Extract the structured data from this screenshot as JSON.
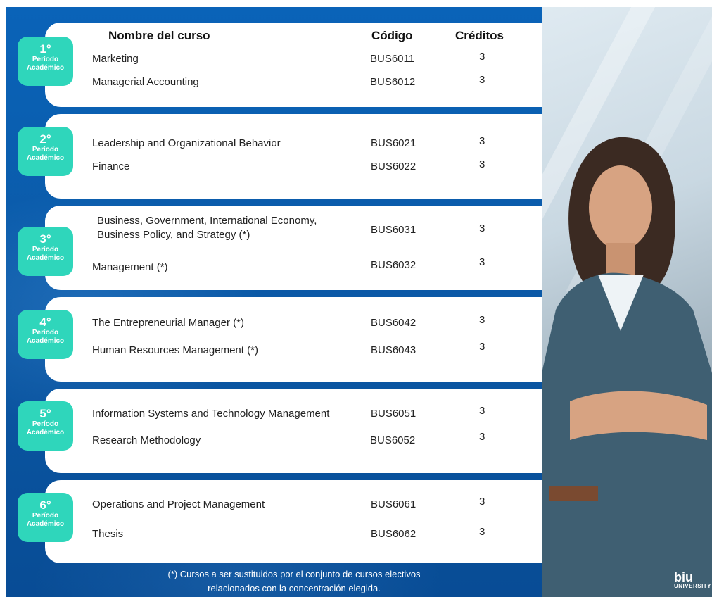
{
  "headers": {
    "course": "Nombre del curso",
    "code": "Código",
    "credits": "Créditos"
  },
  "periods": [
    {
      "num": "1°",
      "label1": "Período",
      "label2": "Académico",
      "courses": [
        {
          "name": "Marketing",
          "code": "BUS6011",
          "credits": "3"
        },
        {
          "name": "Managerial Accounting",
          "code": "BUS6012",
          "credits": "3"
        }
      ]
    },
    {
      "num": "2°",
      "label1": "Período",
      "label2": "Académico",
      "courses": [
        {
          "name": "Leadership and Organizational Behavior",
          "code": "BUS6021",
          "credits": "3"
        },
        {
          "name": "Finance",
          "code": "BUS6022",
          "credits": "3"
        }
      ]
    },
    {
      "num": "3°",
      "label1": "Período",
      "label2": "Académico",
      "courses": [
        {
          "name": "Business, Government, International Economy, Business Policy, and Strategy (*)",
          "code": "BUS6031",
          "credits": "3"
        },
        {
          "name": "Management (*)",
          "code": "BUS6032",
          "credits": "3"
        }
      ]
    },
    {
      "num": "4°",
      "label1": "Período",
      "label2": "Académico",
      "courses": [
        {
          "name": "The Entrepreneurial Manager (*)",
          "code": "BUS6042",
          "credits": "3"
        },
        {
          "name": "Human Resources Management (*)",
          "code": "BUS6043",
          "credits": "3"
        }
      ]
    },
    {
      "num": "5°",
      "label1": "Período",
      "label2": "Académico",
      "courses": [
        {
          "name": "Information Systems and Technology Management",
          "code": "BUS6051",
          "credits": "3"
        },
        {
          "name": "Research Methodology",
          "code": "BUS6052",
          "credits": "3"
        }
      ]
    },
    {
      "num": "6°",
      "label1": "Período",
      "label2": "Académico",
      "courses": [
        {
          "name": "Operations and Project Management",
          "code": "BUS6061",
          "credits": "3"
        },
        {
          "name": "Thesis",
          "code": "BUS6062",
          "credits": "3"
        }
      ]
    }
  ],
  "footnote": {
    "line1": "(*) Cursos a ser sustituidos por el conjunto de cursos electivos",
    "line2": "relacionados con la concentración elegida."
  },
  "logo": {
    "text": "biu",
    "sub": "UNIVERSITY"
  },
  "colors": {
    "panel": "#0a63b8",
    "badge": "#2fd6bb",
    "band": "#ffffff"
  }
}
